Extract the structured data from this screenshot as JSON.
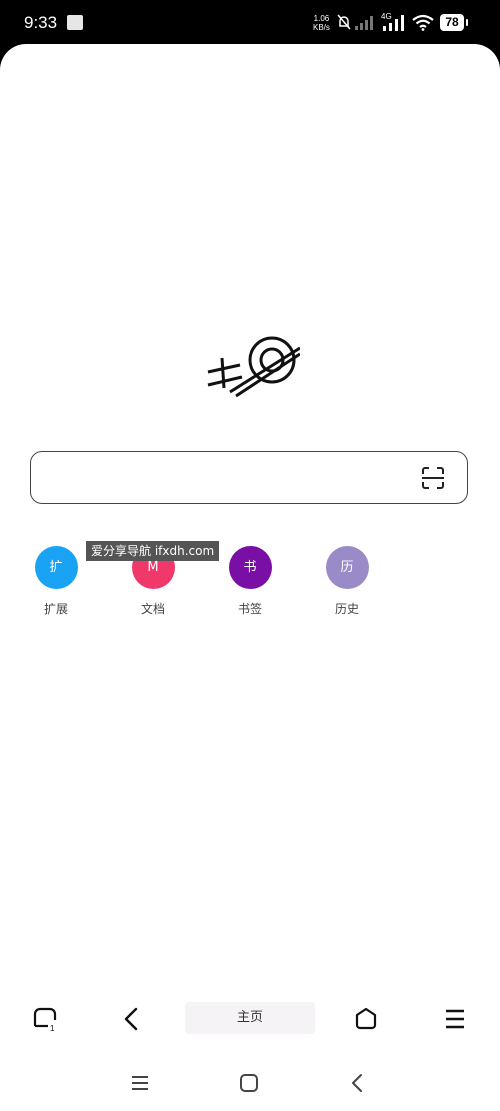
{
  "status_bar": {
    "time": "9:33",
    "net_speed_value": "1.06",
    "net_speed_unit": "KB/s",
    "network_type": "4G",
    "battery": "78"
  },
  "search": {
    "value": "",
    "placeholder": ""
  },
  "shortcuts": [
    {
      "glyph": "扩",
      "label": "扩展",
      "color": "#1aa3f5"
    },
    {
      "glyph": "M",
      "label": "文档",
      "color": "#f0386a"
    },
    {
      "glyph": "书",
      "label": "书签",
      "color": "#7a0fa6"
    },
    {
      "glyph": "历",
      "label": "历史",
      "color": "#9a8ac8"
    }
  ],
  "watermark": "爱分享导航 ifxdh.com",
  "toolbar": {
    "home_label": "主页",
    "tab_count": "1"
  },
  "icons": {
    "tabs": "tabs-icon",
    "back": "back-arrow-icon",
    "home": "home-icon",
    "menu": "menu-icon",
    "scan": "scan-icon"
  }
}
